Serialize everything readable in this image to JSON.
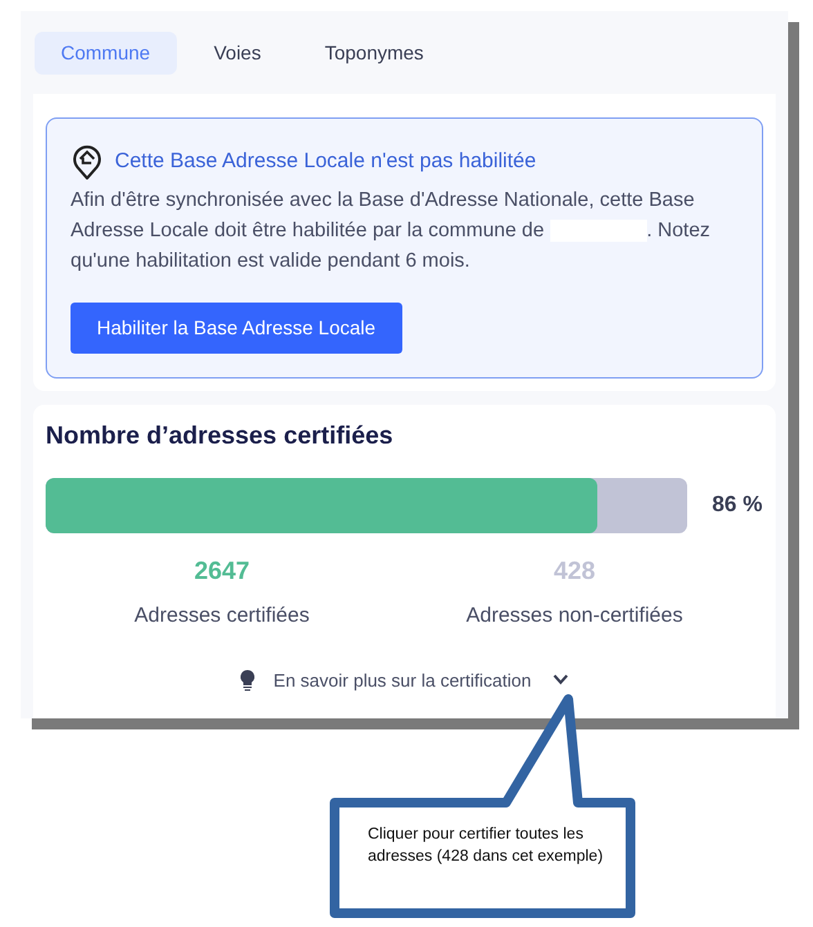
{
  "tabs": [
    {
      "label": "Commune",
      "selected": true
    },
    {
      "label": "Voies",
      "selected": false
    },
    {
      "label": "Toponymes",
      "selected": false
    }
  ],
  "alert": {
    "title": "Cette Base Adresse Locale n'est pas habilitée",
    "body_before": "Afin d'être synchronisée avec la Base d'Adresse Nationale, cette Base Adresse Locale doit être habilitée par la commune de",
    "body_after": ". Notez qu'une habilitation est valide pendant 6 mois.",
    "button": "Habiliter la Base Adresse Locale"
  },
  "stats": {
    "title": "Nombre d’adresses certifiées",
    "level": 0.86,
    "percent": "86 %",
    "counts": [
      {
        "value": "2647",
        "label": "Adresses certifiées",
        "color": "#53bc94"
      },
      {
        "value": "428",
        "label": "Adresses non-certifiées",
        "color": "#c1c3d6"
      }
    ],
    "more_link": "En savoir plus sur la certification",
    "expanded": false
  },
  "callout": {
    "text": "Cliquer pour certifier toutes les adresses (428 dans cet exemple)"
  }
}
